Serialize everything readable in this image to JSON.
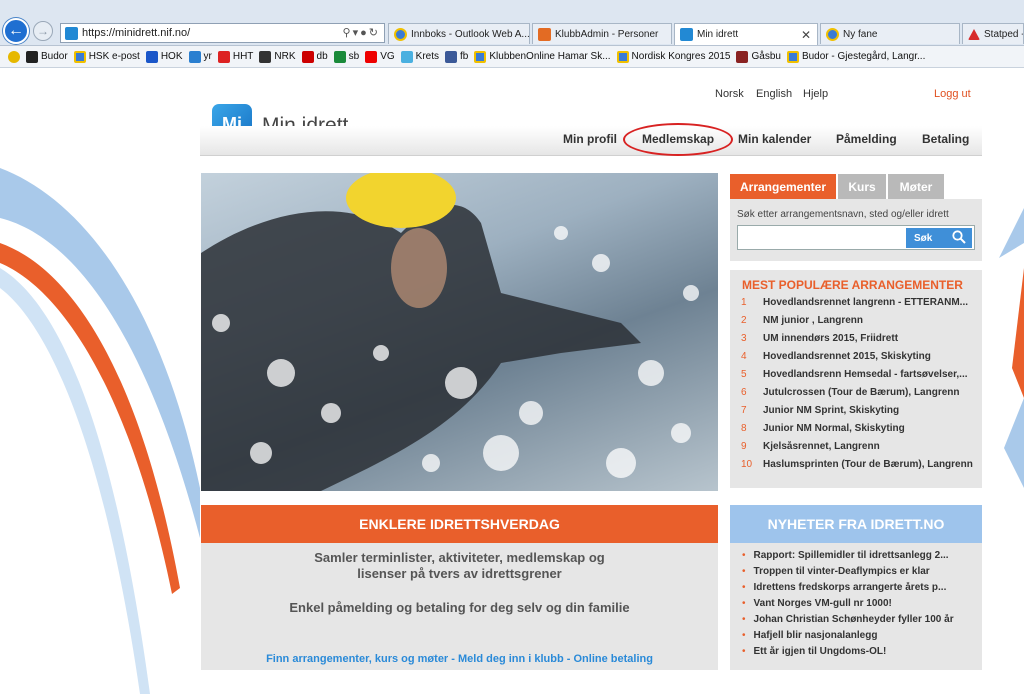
{
  "browser": {
    "url": "https://minidrett.nif.no/",
    "tabs": [
      {
        "title": "Innboks - Outlook Web A..."
      },
      {
        "title": "KlubbAdmin - Personer"
      },
      {
        "title": "Min idrett",
        "active": true
      },
      {
        "title": "Ny fane"
      },
      {
        "title": "Statped -"
      }
    ],
    "favorites": [
      "Budor",
      "HSK e-post",
      "HOK",
      "yr",
      "HHT",
      "NRK",
      "db",
      "sb",
      "VG",
      "Krets",
      "fb",
      "KlubbenOnline Hamar Sk...",
      "Nordisk Kongres 2015",
      "Gåsbu",
      "Budor - Gjestegård, Langr..."
    ]
  },
  "site": {
    "logo_mark": "Mi",
    "logo_text": "Min idrett",
    "toplinks": {
      "norsk": "Norsk",
      "english": "English",
      "help": "Hjelp",
      "logout": "Logg ut"
    },
    "nav": [
      "Min profil",
      "Medlemskap",
      "Min kalender",
      "Påmelding",
      "Betaling"
    ]
  },
  "search": {
    "tabs": [
      "Arrangementer",
      "Kurs",
      "Møter"
    ],
    "label": "Søk etter arrangementsnavn, sted og/eller idrett",
    "placeholder": "",
    "button": "Søk"
  },
  "popular": {
    "title": "MEST POPULÆRE ARRANGEMENTER",
    "items": [
      {
        "num": "1",
        "text": "Hovedlandsrennet langrenn - ETTERANM..."
      },
      {
        "num": "2",
        "text": "NM junior , Langrenn"
      },
      {
        "num": "3",
        "text": "UM innendørs 2015, Friidrett"
      },
      {
        "num": "4",
        "text": "Hovedlandsrennet 2015, Skiskyting"
      },
      {
        "num": "5",
        "text": "Hovedlandsrenn Hemsedal - fartsøvelser,..."
      },
      {
        "num": "6",
        "text": "Jutulcrossen (Tour de Bærum), Langrenn"
      },
      {
        "num": "7",
        "text": "Junior NM Sprint, Skiskyting"
      },
      {
        "num": "8",
        "text": "Junior NM Normal, Skiskyting"
      },
      {
        "num": "9",
        "text": "Kjelsåsrennet, Langrenn"
      },
      {
        "num": "10",
        "text": "Haslumsprinten (Tour de Bærum), Langrenn"
      }
    ]
  },
  "promo": {
    "title": "ENKLERE IDRETTSHVERDAG",
    "line1": "Samler terminlister, aktiviteter, medlemskap og",
    "line2": "lisenser på tvers av idrettsgrener",
    "line3": "Enkel påmelding og betaling for deg selv og din familie",
    "links": "Finn arrangementer, kurs og møter - Meld deg inn i klubb - Online betaling"
  },
  "news": {
    "title": "NYHETER FRA IDRETT.NO",
    "items": [
      "Rapport: Spillemidler til idrettsanlegg 2...",
      "Troppen til vinter-Deaflympics er klar",
      "Idrettens fredskorps arrangerte årets p...",
      "Vant Norges VM-gull nr 1000!",
      "Johan Christian Schønheyder fyller 100 år",
      "Hafjell blir nasjonalanlegg",
      "Ett år igjen til Ungdoms-OL!"
    ]
  },
  "colors": {
    "accent": "#e95f2b",
    "blue": "#2289d4",
    "news_header": "#9ec4ec",
    "highlight_ring": "#d82222"
  }
}
